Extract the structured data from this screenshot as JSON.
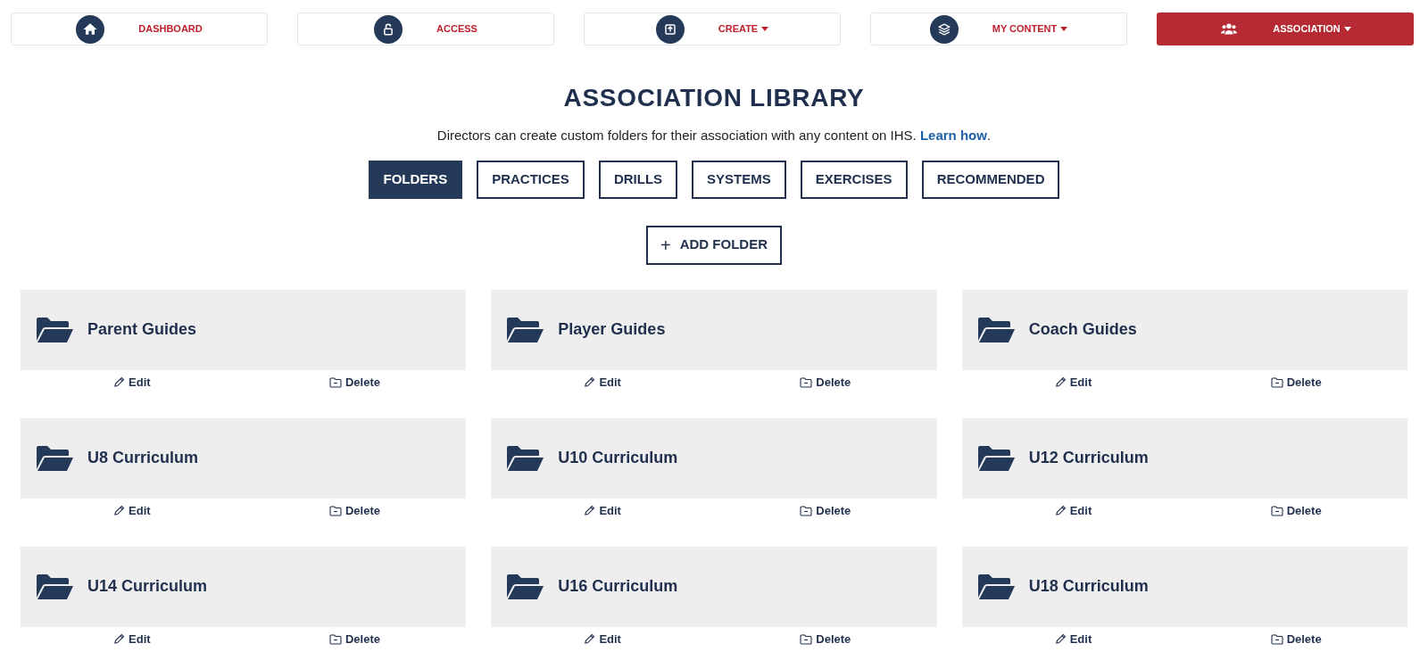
{
  "nav": [
    {
      "kind": "home",
      "label": "DASHBOARD",
      "dropdown": false,
      "selected": false
    },
    {
      "kind": "lock",
      "label": "ACCESS",
      "dropdown": false,
      "selected": false
    },
    {
      "kind": "upload",
      "label": "CREATE",
      "dropdown": true,
      "selected": false
    },
    {
      "kind": "layers",
      "label": "MY CONTENT",
      "dropdown": true,
      "selected": false
    },
    {
      "kind": "users",
      "label": "ASSOCIATION",
      "dropdown": true,
      "selected": true
    }
  ],
  "title": "ASSOCIATION LIBRARY",
  "intro": {
    "text": "Directors can create custom folders for their association with any content on IHS.",
    "link": "Learn how",
    "after": "."
  },
  "tabs": [
    {
      "label": "FOLDERS",
      "selected": true
    },
    {
      "label": "PRACTICES",
      "selected": false
    },
    {
      "label": "DRILLS",
      "selected": false
    },
    {
      "label": "SYSTEMS",
      "selected": false
    },
    {
      "label": "EXERCISES",
      "selected": false
    },
    {
      "label": "RECOMMENDED",
      "selected": false
    }
  ],
  "add_button": {
    "icon": "+",
    "label": "ADD FOLDER"
  },
  "folders": [
    {
      "name": "Parent Guides",
      "edit": "Edit",
      "delete": "Delete"
    },
    {
      "name": "Player Guides",
      "edit": "Edit",
      "delete": "Delete"
    },
    {
      "name": "Coach Guides",
      "edit": "Edit",
      "delete": "Delete"
    },
    {
      "name": "U8 Curriculum",
      "edit": "Edit",
      "delete": "Delete"
    },
    {
      "name": "U10 Curriculum",
      "edit": "Edit",
      "delete": "Delete"
    },
    {
      "name": "U12 Curriculum",
      "edit": "Edit",
      "delete": "Delete"
    },
    {
      "name": "U14 Curriculum",
      "edit": "Edit",
      "delete": "Delete"
    },
    {
      "name": "U16 Curriculum",
      "edit": "Edit",
      "delete": "Delete"
    },
    {
      "name": "U18 Curriculum",
      "edit": "Edit",
      "delete": "Delete"
    }
  ]
}
